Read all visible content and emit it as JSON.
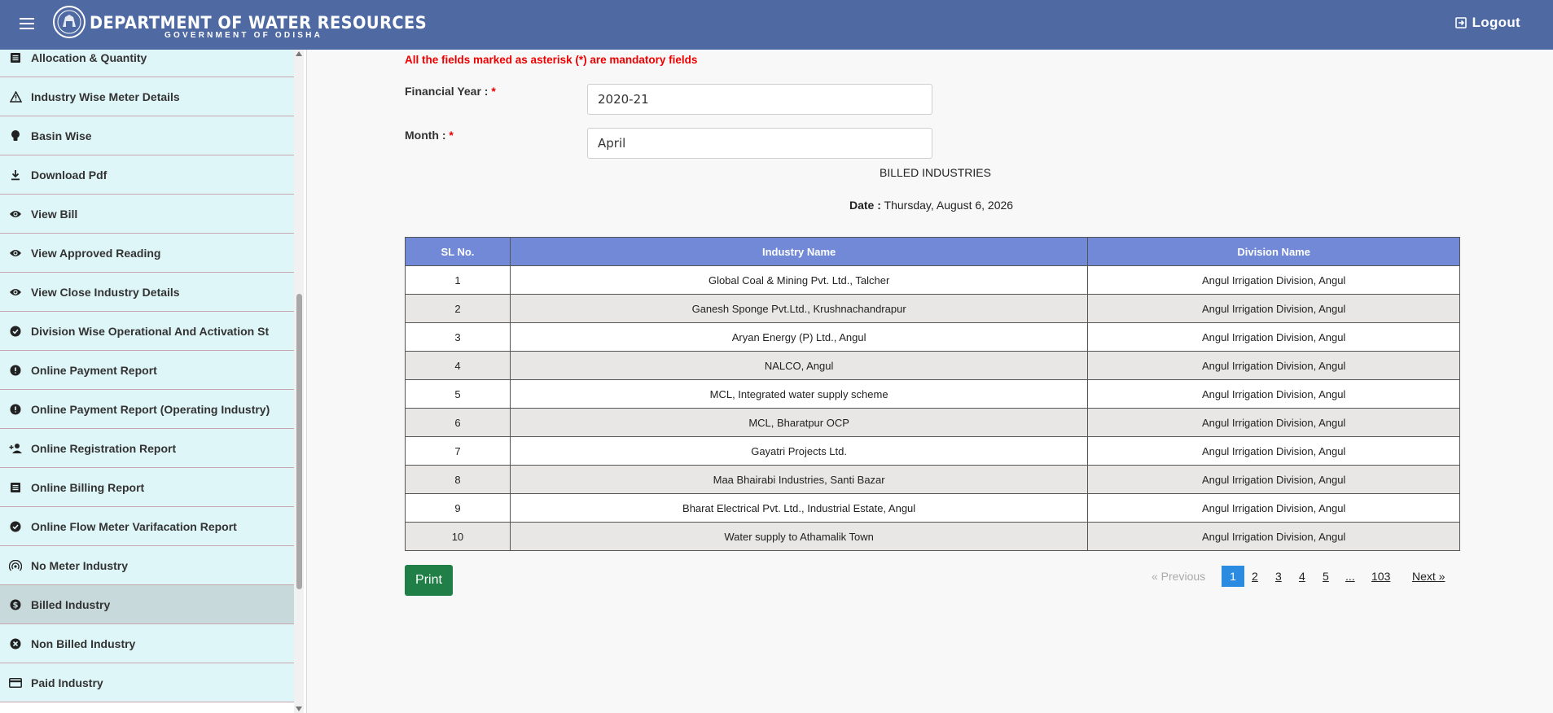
{
  "header": {
    "title": "DEPARTMENT OF WATER RESOURCES",
    "subtitle": "GOVERNMENT OF ODISHA",
    "logout_label": "Logout"
  },
  "sidebar": {
    "items": [
      {
        "label": "Allocation & Quantity",
        "icon": "list-icon"
      },
      {
        "label": "Industry Wise Meter Details",
        "icon": "warning-icon"
      },
      {
        "label": "Basin Wise",
        "icon": "bulb-icon"
      },
      {
        "label": "Download Pdf",
        "icon": "download-icon"
      },
      {
        "label": "View Bill",
        "icon": "eye-icon"
      },
      {
        "label": "View Approved Reading",
        "icon": "eye-icon"
      },
      {
        "label": "View Close Industry Details",
        "icon": "eye-icon"
      },
      {
        "label": "Division Wise Operational And Activation St",
        "icon": "check-circle-icon"
      },
      {
        "label": "Online Payment Report",
        "icon": "alert-circle-icon"
      },
      {
        "label": "Online Payment Report (Operating Industry)",
        "icon": "alert-circle-icon"
      },
      {
        "label": "Online Registration Report",
        "icon": "person-add-icon"
      },
      {
        "label": "Online Billing Report",
        "icon": "list-icon"
      },
      {
        "label": "Online Flow Meter Varifacation Report",
        "icon": "check-circle-icon"
      },
      {
        "label": "No Meter Industry",
        "icon": "broadcast-icon"
      },
      {
        "label": "Billed Industry",
        "icon": "dollar-circle-icon",
        "active": true
      },
      {
        "label": "Non Billed Industry",
        "icon": "cancel-circle-icon"
      },
      {
        "label": "Paid Industry",
        "icon": "credit-card-icon"
      }
    ]
  },
  "form": {
    "mandatory_note": "All the fields marked as asterisk (*) are mandatory fields",
    "financial_year_label": "Financial Year :",
    "financial_year_value": "2020-21",
    "month_label": "Month :",
    "month_value": "April",
    "asterisk": "*"
  },
  "report": {
    "title": "BILLED INDUSTRIES",
    "date_label": "Date :",
    "date_value": "Thursday, August 6, 2026"
  },
  "table": {
    "headers": [
      "SL No.",
      "Industry Name",
      "Division Name"
    ],
    "rows": [
      [
        "1",
        "Global Coal & Mining Pvt. Ltd., Talcher",
        "Angul Irrigation Division, Angul"
      ],
      [
        "2",
        "Ganesh Sponge Pvt.Ltd., Krushnachandrapur",
        "Angul Irrigation Division, Angul"
      ],
      [
        "3",
        "Aryan Energy (P) Ltd., Angul",
        "Angul Irrigation Division, Angul"
      ],
      [
        "4",
        "NALCO, Angul",
        "Angul Irrigation Division, Angul"
      ],
      [
        "5",
        "MCL, Integrated water supply scheme",
        "Angul Irrigation Division, Angul"
      ],
      [
        "6",
        "MCL, Bharatpur OCP",
        "Angul Irrigation Division, Angul"
      ],
      [
        "7",
        "Gayatri Projects Ltd.",
        "Angul Irrigation Division, Angul"
      ],
      [
        "8",
        "Maa Bhairabi Industries, Santi Bazar",
        "Angul Irrigation Division, Angul"
      ],
      [
        "9",
        "Bharat Electrical Pvt. Ltd., Industrial Estate, Angul",
        "Angul Irrigation Division, Angul"
      ],
      [
        "10",
        "Water supply to Athamalik Town",
        "Angul Irrigation Division, Angul"
      ]
    ]
  },
  "actions": {
    "print_label": "Print"
  },
  "pagination": {
    "previous_label": "« Previous",
    "pages": [
      "1",
      "2",
      "3",
      "4",
      "5",
      "...",
      "103"
    ],
    "current": "1",
    "next_label": "Next »"
  },
  "colors": {
    "header_bg": "#4f6aa3",
    "sidebar_item_bg": "#dff6f8",
    "sidebar_active_bg": "#c8d9dc",
    "table_header_bg": "#7189d6",
    "print_bg": "#1f7f47",
    "page_current_bg": "#2b8be0",
    "mandatory_text": "#ee0000"
  }
}
